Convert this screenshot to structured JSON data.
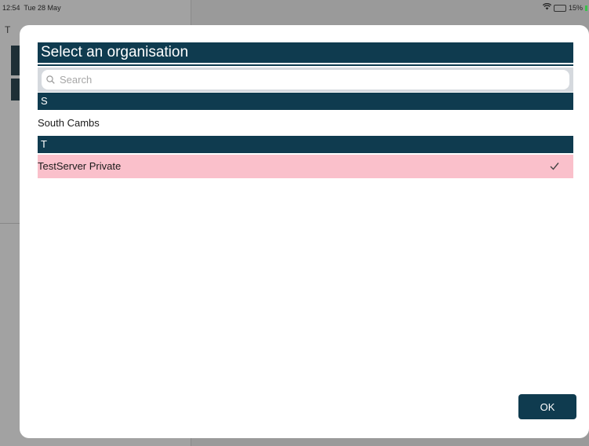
{
  "status_bar": {
    "time": "12:54",
    "date": "Tue 28 May",
    "battery_percent": "15%",
    "battery_level": 0.15
  },
  "background": {
    "sidebar_title_fragment": "T"
  },
  "modal": {
    "title": "Select an organisation",
    "search": {
      "placeholder": "Search",
      "value": ""
    },
    "sections": [
      {
        "header": "S",
        "items": [
          {
            "label": "South Cambs",
            "selected": false
          }
        ]
      },
      {
        "header": "T",
        "items": [
          {
            "label": "TestServer Private",
            "selected": true
          }
        ]
      }
    ],
    "ok_label": "OK"
  },
  "colors": {
    "header_bg": "#0f3b4f",
    "selected_row_bg": "#fac0cb",
    "search_bar_bg": "#d5d9de"
  },
  "icons": {
    "search": "search-icon",
    "check": "checkmark-icon",
    "wifi": "wifi-icon",
    "battery": "battery-icon"
  }
}
